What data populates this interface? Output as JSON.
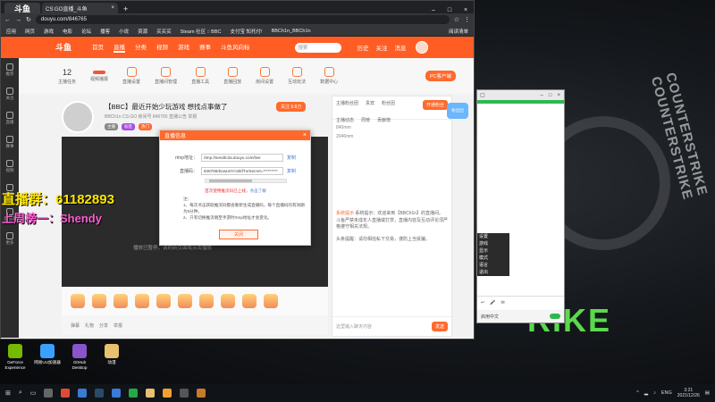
{
  "overlay": {
    "line1": "直播群：61182893",
    "line2": "上周榜一：Shendy"
  },
  "wallpaper": {
    "watermark": "COUNTERSTRIKE COUNTERSTRIKE",
    "strike": "RIKE"
  },
  "browser": {
    "tab_logo": "斗鱼",
    "tab_title": "CS:GO直播_斗鱼",
    "url": "douyu.com/846765",
    "bookmarks": [
      "应用",
      "网页",
      "游戏",
      "电影",
      "论坛",
      "播客",
      "小说",
      "资源",
      "买买买",
      "Steam 社区 :: BBC",
      "支付宝 知托付!",
      "BBCh1n_BBCh1n"
    ],
    "bookmarks_right": "阅读清单"
  },
  "douyu": {
    "logo": "斗鱼",
    "nav": [
      "首页",
      "直播",
      "分类",
      "视频",
      "游戏",
      "赛事",
      "斗鱼风向标"
    ],
    "search_placeholder": "搜索",
    "header_icons": [
      "历史",
      "关注",
      "消息"
    ]
  },
  "sidebar": [
    "推荐",
    "关注",
    "直播",
    "赛事",
    "视频",
    "游戏",
    "云游戏",
    "更多"
  ],
  "toprow": {
    "count": "12",
    "items": [
      "主播任务",
      "视频播报",
      "直播设置",
      "直播间管理",
      "直播工具",
      "直播回放",
      "房间设置",
      "互动玩法",
      "数据中心"
    ],
    "download": "PC客户端"
  },
  "room": {
    "title": "【BBC】最近开始少玩游戏 想找点事做了",
    "sub": "BBCh1n  CS:GO  房间号 846765  直播公告  举报",
    "tags": [
      "主播",
      "标签",
      "热门"
    ],
    "follow": "关注 9.8万"
  },
  "player": {
    "hint": "播放已暂停，请刷新页面或点击播放"
  },
  "player_bar2": [
    "弹幕",
    "礼物",
    "分享",
    "举报"
  ],
  "chat": {
    "tabs": [
      "主播粉丝团",
      "贵宾",
      "粉丝团",
      "主播动态",
      "周榜",
      "贡献榜"
    ],
    "tab_button": "开通粉丝",
    "msgs": [
      "840mm",
      "2046mm"
    ],
    "notice": "系统提示：欢迎来到【BBCh1n】的直播间。斗鱼严禁未成年人直播或打赏，直播内容及互动评论须严格遵守相关法规。",
    "notice_hl": "系统提示",
    "notice2": "头条提醒：请勿相信私下交易，谨防上当受骗。",
    "input_placeholder": "这里输入聊天内容",
    "send": "发送",
    "badge": "粉丝团"
  },
  "modal": {
    "title": "直播信息",
    "close": "×",
    "rtmp_label": "rtmp地址：",
    "rtmp_value": "rtmp://sendtc3a.douyu.com/live",
    "key_label": "直播码：",
    "key_value": "846765rbowuHYct4kfTxrSecret=*********",
    "copy": "复制",
    "warn": "首次使用推流码已上线，",
    "warn_link": "点击了解",
    "note_title": "注：",
    "notes": [
      "1、每次点击获取推流码都会重新生成直播码，每个直播码的有效期为5分钟。",
      "2、只有切换推流端至手游时rtmp地址才会变化。"
    ],
    "confirm": "关闭"
  },
  "win2": {
    "title": "",
    "list": [
      "设置",
      "游戏",
      "显示",
      "模式",
      "语言",
      "退出"
    ],
    "bottom_icons": [
      "↩",
      "🎤",
      "✉"
    ],
    "bottom2": "启用中文"
  },
  "desktop_icons": [
    {
      "label": "GeForce Experience",
      "color": "#76b900"
    },
    {
      "label": "网易UU加速器",
      "color": "#3aa0ff"
    },
    {
      "label": "GitHub Desktop",
      "color": "#8855cc"
    },
    {
      "label": "动漫",
      "color": "#e8c070"
    }
  ],
  "taskbar": {
    "lang": "ENG",
    "time": "3:21",
    "date": "2021/12/26"
  }
}
